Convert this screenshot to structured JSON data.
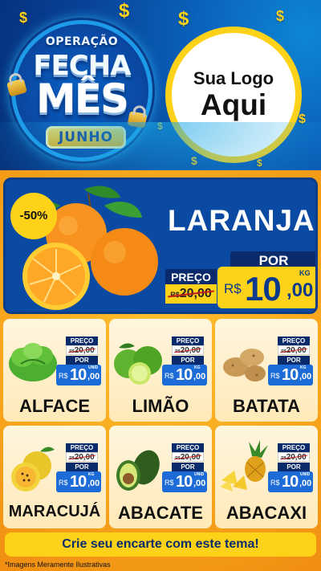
{
  "campaign": {
    "line1": "OPERAÇÃO",
    "line2": "FECHA",
    "line3": "MÊS",
    "month": "JUNHO"
  },
  "logo": {
    "line1": "Sua Logo",
    "line2": "Aqui"
  },
  "featured": {
    "name": "LARANJA",
    "discount": "-50%",
    "price_label": "PREÇO",
    "old_currency": "R$",
    "old_price": "20,00",
    "new_label": "POR",
    "currency": "R$",
    "price_int": "10",
    "price_dec": ",00",
    "unit": "KG",
    "icon": "orange-icon"
  },
  "products": [
    {
      "name": "ALFACE",
      "icon": "lettuce-icon",
      "price_label": "PREÇO",
      "old_currency": "R$",
      "old_price": "20,00",
      "new_label": "POR",
      "currency": "R$",
      "price_int": "10",
      "price_dec": ",00",
      "unit": "UNID"
    },
    {
      "name": "LIMÃO",
      "icon": "lime-icon",
      "price_label": "PREÇO",
      "old_currency": "R$",
      "old_price": "20,00",
      "new_label": "POR",
      "currency": "R$",
      "price_int": "10",
      "price_dec": ",00",
      "unit": "KG"
    },
    {
      "name": "BATATA",
      "icon": "potato-icon",
      "price_label": "PREÇO",
      "old_currency": "R$",
      "old_price": "20,00",
      "new_label": "POR",
      "currency": "R$",
      "price_int": "10",
      "price_dec": ",00",
      "unit": "KG"
    },
    {
      "name": "MARACUJÁ",
      "icon": "passion-fruit-icon",
      "price_label": "PREÇO",
      "old_currency": "R$",
      "old_price": "20,00",
      "new_label": "POR",
      "currency": "R$",
      "price_int": "10",
      "price_dec": ",00",
      "unit": "KG"
    },
    {
      "name": "ABACATE",
      "icon": "avocado-icon",
      "price_label": "PREÇO",
      "old_currency": "R$",
      "old_price": "20,00",
      "new_label": "POR",
      "currency": "R$",
      "price_int": "10",
      "price_dec": ",00",
      "unit": "UNID"
    },
    {
      "name": "ABACAXI",
      "icon": "pineapple-icon",
      "price_label": "PREÇO",
      "old_currency": "R$",
      "old_price": "20,00",
      "new_label": "POR",
      "currency": "R$",
      "price_int": "10",
      "price_dec": ",00",
      "unit": "UNID"
    }
  ],
  "cta": "Crie seu encarte com este tema!",
  "disclaimer": "*Imagens Meramente Ilustrativas",
  "colors": {
    "header_blue": "#0a5fb8",
    "panel_blue": "#0b4aa3",
    "accent_yellow": "#ffd21a",
    "background_orange": "#f7a51b",
    "price_blue": "#1c6bd6"
  }
}
